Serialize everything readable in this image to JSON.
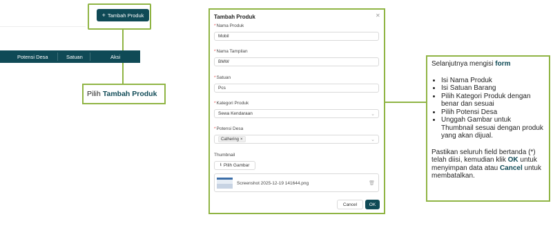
{
  "toolbar": {
    "add_product_label": "Tambah Produk"
  },
  "table": {
    "columns": [
      "Potensi Desa",
      "Satuan",
      "Aksi"
    ]
  },
  "callout_left": {
    "prefix": "Pilih",
    "emphasis": "Tambah Produk"
  },
  "modal": {
    "title": "Tambah Produk",
    "fields": {
      "nama_produk": {
        "label": "Nama Produk",
        "value": "Mobil"
      },
      "nama_tampilan": {
        "label": "Nama Tampilan",
        "value": "BMW"
      },
      "satuan": {
        "label": "Satuan",
        "value": "Pcs"
      },
      "kategori": {
        "label": "Kategori Produk",
        "value": "Sewa Kendaraan"
      },
      "potensi": {
        "label": "Potensi Desa",
        "tag": "Cathering"
      }
    },
    "thumbnail": {
      "label": "Thumbnail",
      "pick_label": "Pilih Gambar",
      "file_name": "Screenshot 2025-12-19 141644.png"
    },
    "cancel_label": "Cancel",
    "ok_label": "OK"
  },
  "callout_right": {
    "intro": "Selanjutnya mengisi",
    "intro_bold": "form",
    "items": [
      "Isi Nama Produk",
      "Isi Satuan Barang",
      "Pilih Kategori Produk dengan benar dan sesuai",
      "Pilih Potensi Desa",
      "Unggah Gambar untuk Thumbnail sesuai dengan produk yang akan dijual."
    ],
    "footer": {
      "part1": "Pastikan seluruh field bertanda (*) telah diisi, kemudian klik",
      "ok": "OK",
      "part2": "untuk menyimpan data atau",
      "cancel": "Cancel",
      "part3": "untuk membatalkan."
    }
  },
  "colors": {
    "accent": "#8fb443",
    "primary": "#0f4a56"
  }
}
